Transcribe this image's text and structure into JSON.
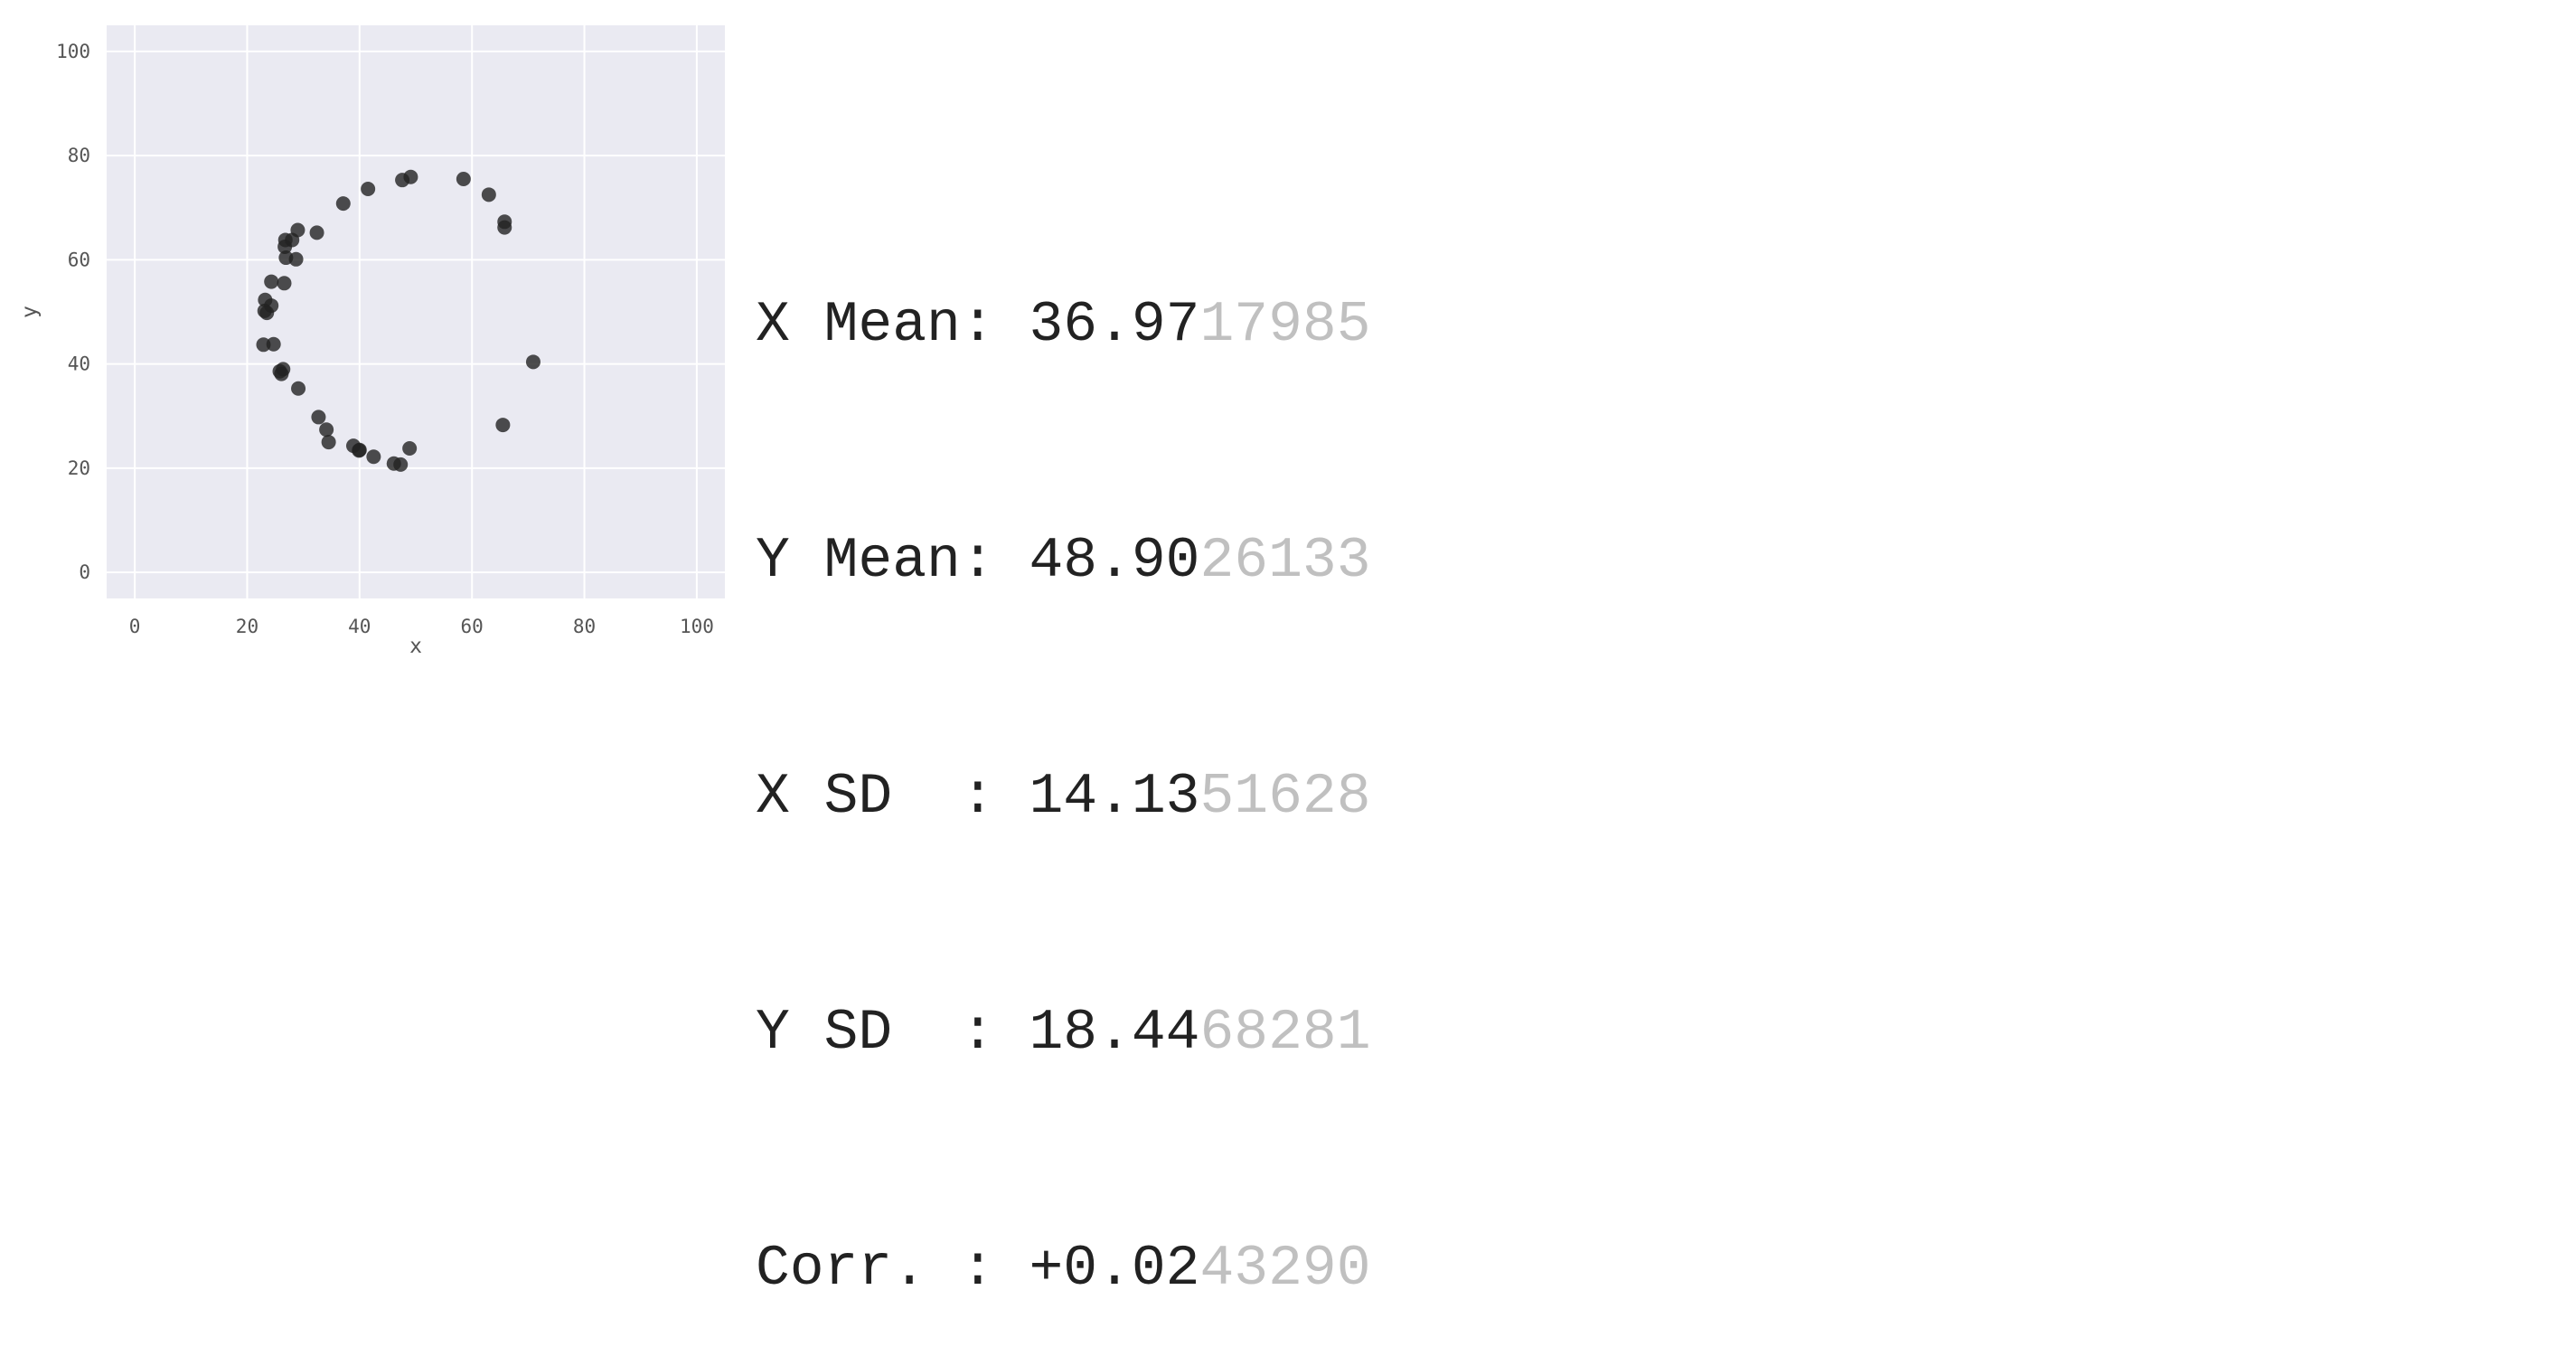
{
  "chart_data": {
    "type": "scatter",
    "xlabel": "x",
    "ylabel": "y",
    "xlim": [
      -5,
      105
    ],
    "ylim": [
      -5,
      105
    ],
    "xticks": [
      0,
      20,
      40,
      60,
      80,
      100
    ],
    "yticks": [
      0,
      20,
      40,
      60,
      80,
      100
    ],
    "grid": true,
    "point_color": "#222222",
    "background_color": "#EAEAF2",
    "points": [
      {
        "x": 49.1,
        "y": 75.9
      },
      {
        "x": 47.6,
        "y": 75.3
      },
      {
        "x": 41.5,
        "y": 73.6
      },
      {
        "x": 37.1,
        "y": 70.8
      },
      {
        "x": 58.5,
        "y": 75.5
      },
      {
        "x": 63.0,
        "y": 72.5
      },
      {
        "x": 65.8,
        "y": 67.3
      },
      {
        "x": 65.8,
        "y": 66.2
      },
      {
        "x": 32.4,
        "y": 65.2
      },
      {
        "x": 29.0,
        "y": 65.7
      },
      {
        "x": 28.0,
        "y": 63.8
      },
      {
        "x": 26.8,
        "y": 63.8
      },
      {
        "x": 26.7,
        "y": 62.5
      },
      {
        "x": 26.9,
        "y": 60.4
      },
      {
        "x": 28.7,
        "y": 60.1
      },
      {
        "x": 24.3,
        "y": 55.8
      },
      {
        "x": 26.6,
        "y": 55.5
      },
      {
        "x": 23.2,
        "y": 52.3
      },
      {
        "x": 24.3,
        "y": 51.2
      },
      {
        "x": 23.1,
        "y": 50.2
      },
      {
        "x": 23.5,
        "y": 49.8
      },
      {
        "x": 22.9,
        "y": 43.7
      },
      {
        "x": 24.7,
        "y": 43.8
      },
      {
        "x": 26.4,
        "y": 39.0
      },
      {
        "x": 25.8,
        "y": 38.6
      },
      {
        "x": 26.1,
        "y": 38.1
      },
      {
        "x": 29.1,
        "y": 35.3
      },
      {
        "x": 70.9,
        "y": 40.4
      },
      {
        "x": 65.5,
        "y": 28.3
      },
      {
        "x": 32.7,
        "y": 29.8
      },
      {
        "x": 34.1,
        "y": 27.4
      },
      {
        "x": 34.5,
        "y": 25.0
      },
      {
        "x": 38.9,
        "y": 24.3
      },
      {
        "x": 39.9,
        "y": 23.4
      },
      {
        "x": 40.0,
        "y": 23.5
      },
      {
        "x": 42.5,
        "y": 22.2
      },
      {
        "x": 48.9,
        "y": 23.8
      },
      {
        "x": 46.1,
        "y": 20.9
      },
      {
        "x": 47.3,
        "y": 20.7
      }
    ]
  },
  "stats": [
    {
      "label": "X Mean: ",
      "bold_value": "36.97",
      "faded_value": "17985"
    },
    {
      "label": "Y Mean: ",
      "bold_value": "48.90",
      "faded_value": "26133"
    },
    {
      "label": "X SD  : ",
      "bold_value": "14.13",
      "faded_value": "51628"
    },
    {
      "label": "Y SD  : ",
      "bold_value": "18.44",
      "faded_value": "68281"
    },
    {
      "label": "Corr. : ",
      "bold_value": "+0.02",
      "faded_value": "43290"
    }
  ]
}
